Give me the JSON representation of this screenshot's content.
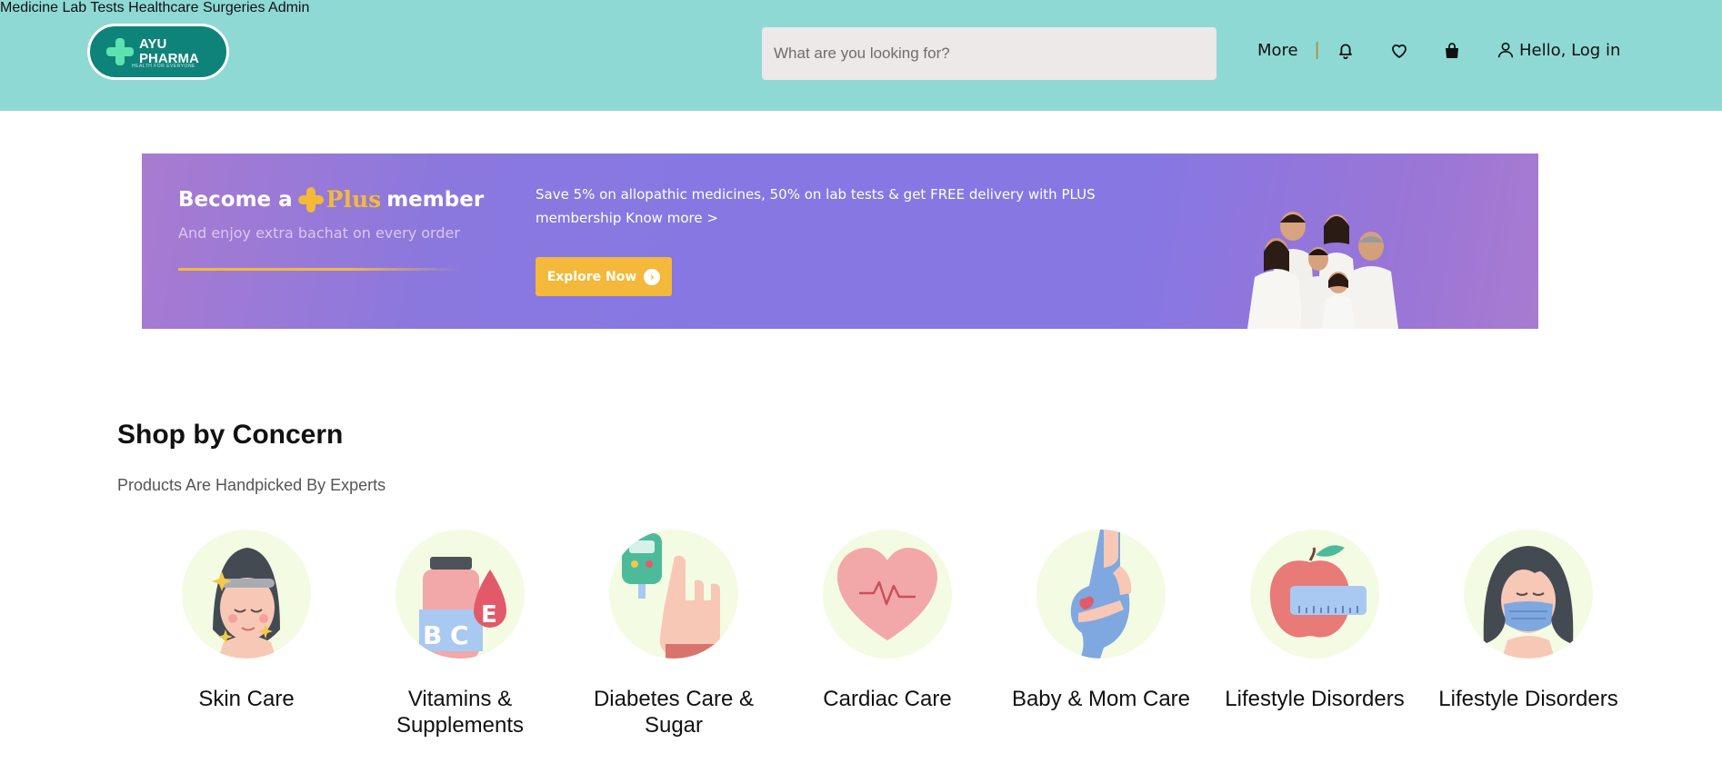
{
  "header": {
    "logo_line1": "AYU",
    "logo_line2": "PHARMA",
    "logo_tagline": "HEALTH FOR EVERYONE",
    "nav": [
      "Medicine",
      "Lab Tests",
      "Healthcare",
      "Surgeries",
      "Admin"
    ],
    "search_placeholder": "What are you looking for?",
    "more_label": "More",
    "separator": "|",
    "login_label": "Hello, Log in",
    "icons": [
      "bell-icon",
      "heart-icon",
      "bag-icon",
      "user-icon"
    ]
  },
  "banner": {
    "title_prefix": "Become a",
    "title_plus": "Plus",
    "title_suffix": "member",
    "subtitle": "And enjoy extra bachat on every order",
    "description": "Save 5% on allopathic medicines, 50% on lab tests & get FREE delivery with PLUS membership Know more >",
    "button_label": "Explore Now",
    "colors": {
      "accent": "#f4b83a",
      "background": "#8677e3"
    }
  },
  "section": {
    "title": "Shop by Concern",
    "subtitle": "Products Are Handpicked By Experts",
    "categories": [
      {
        "label": "Skin Care",
        "icon": "skin-care-icon"
      },
      {
        "label": "Vitamins & Supplements",
        "icon": "vitamins-icon"
      },
      {
        "label": "Diabetes Care & Sugar",
        "icon": "diabetes-icon"
      },
      {
        "label": "Cardiac Care",
        "icon": "cardiac-icon"
      },
      {
        "label": "Baby & Mom Care",
        "icon": "baby-mom-icon"
      },
      {
        "label": "Lifestyle Disorders",
        "icon": "lifestyle-apple-icon"
      },
      {
        "label": "Lifestyle Disorders",
        "icon": "lifestyle-mask-icon"
      }
    ]
  },
  "colors": {
    "header_bg": "#8fd9d5",
    "logo_bg": "#0e8379"
  }
}
